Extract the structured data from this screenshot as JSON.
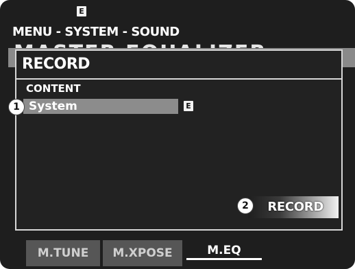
{
  "status_bar": {
    "indicator": "E"
  },
  "header": {
    "menu_path": "MENU - SYSTEM - SOUND",
    "page_title": "MASTER EQUALIZER"
  },
  "dialog": {
    "title": "RECORD",
    "content_label": "CONTENT",
    "content_value": "System",
    "content_indicator": "E",
    "record_button": "RECORD"
  },
  "callouts": {
    "one": "1",
    "two": "2"
  },
  "tabs": [
    {
      "label": "M.TUNE",
      "active": false
    },
    {
      "label": "M.XPOSE",
      "active": false
    },
    {
      "label": "M.EQ",
      "active": true
    }
  ]
}
